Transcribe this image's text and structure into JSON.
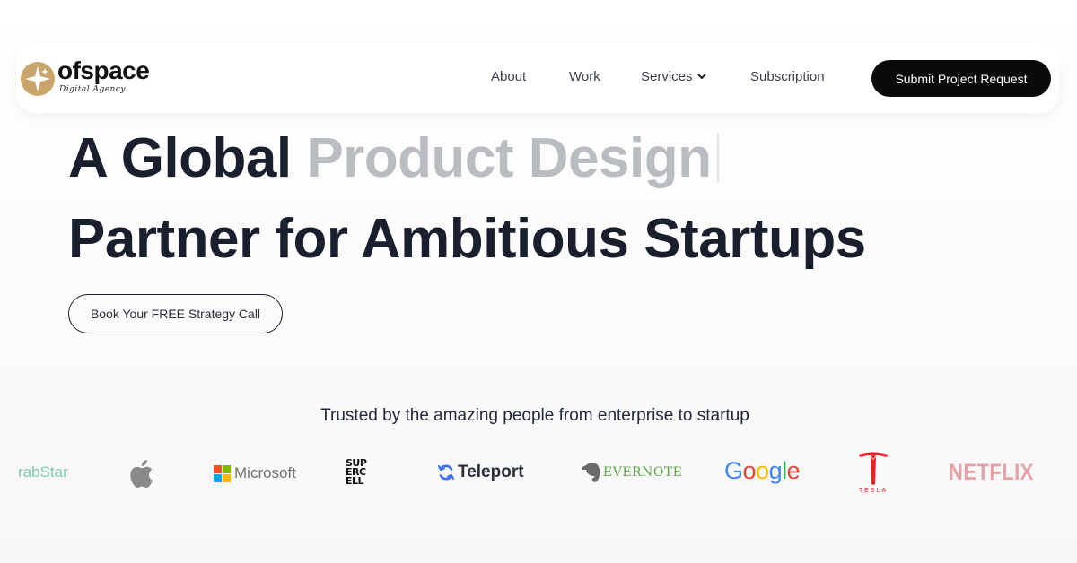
{
  "brand": {
    "name": "ofspace",
    "tagline": "Digital Agency",
    "logo_color": "#c9a46b"
  },
  "nav": {
    "items": [
      {
        "label": "About"
      },
      {
        "label": "Work"
      },
      {
        "label": "Services"
      },
      {
        "label": "Subscription"
      }
    ],
    "cta_label": "Submit Project Request"
  },
  "hero": {
    "line1_start": "A Global ",
    "line1_accent": "Product Design",
    "line2": "Partner for Ambitious Startups",
    "button_label": "Book Your FREE Strategy Call"
  },
  "trusted": {
    "heading": "Trusted by the amazing people from enterprise to startup",
    "logos": [
      {
        "name": "GrabStar",
        "text": "rabStar",
        "color": "#7fc9b5"
      },
      {
        "name": "Apple",
        "icon": "apple-icon",
        "color": "#8a8a8a"
      },
      {
        "name": "Microsoft",
        "text": "Microsoft",
        "color": "#737373"
      },
      {
        "name": "Supercell",
        "text_rows": [
          "SUP",
          "ERC",
          "ELL"
        ],
        "color": "#111111"
      },
      {
        "name": "Teleport",
        "text": "Teleport",
        "color": "#2a2f3a"
      },
      {
        "name": "Evernote",
        "text": "EVERNOTE",
        "color": "#5ba24a"
      },
      {
        "name": "Google",
        "text": "Google"
      },
      {
        "name": "Tesla",
        "text": "TESLA",
        "color": "#e82127"
      },
      {
        "name": "Netflix",
        "text": "NETFLIX",
        "color": "#e8a0a4"
      }
    ]
  }
}
